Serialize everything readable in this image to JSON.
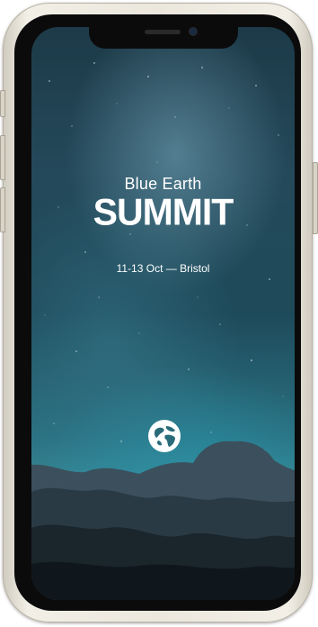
{
  "event": {
    "title_line1": "Blue Earth",
    "title_line2": "SUMMIT",
    "dates": "11-13 Oct — Bristol"
  },
  "icons": {
    "globe": "globe-icon"
  },
  "colors": {
    "sky_top": "#1d3a48",
    "sky_glow": "#3a8f9b",
    "frame": "#ebe7dd",
    "text": "#ffffff"
  }
}
